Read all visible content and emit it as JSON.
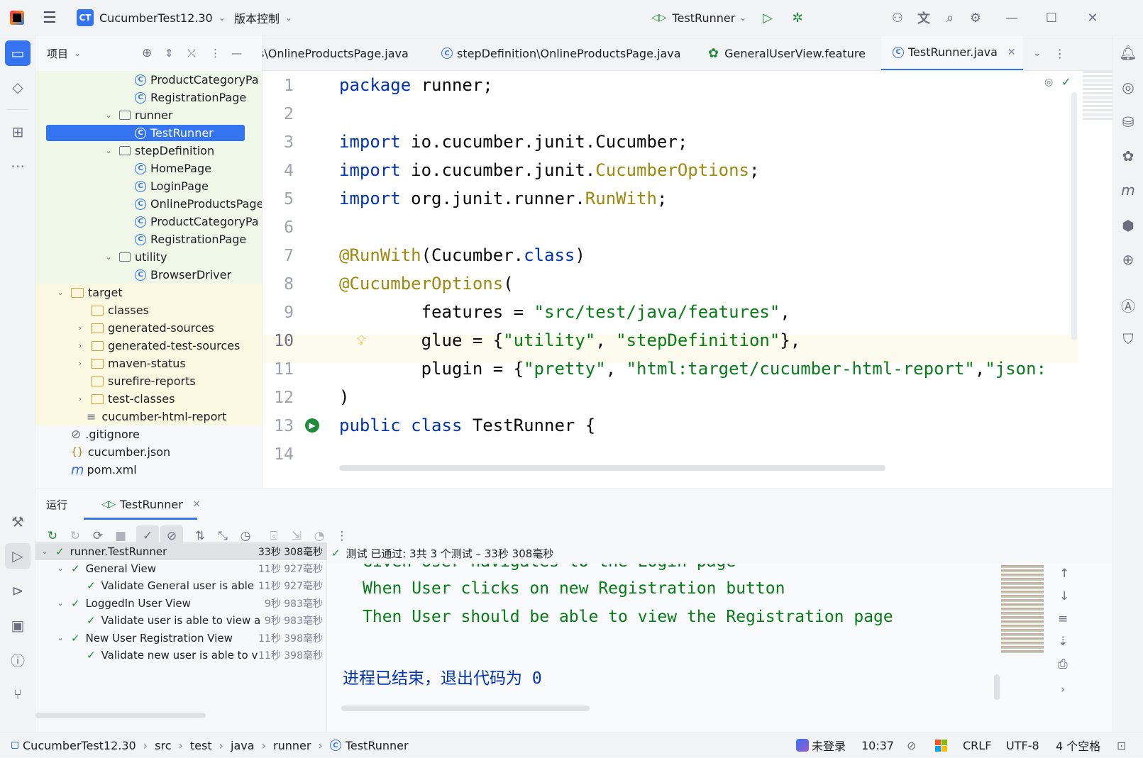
{
  "titlebar": {
    "project_name": "CucumberTest12.30",
    "project_badge": "CT",
    "vcs_label": "版本控制",
    "run_config": "TestRunner"
  },
  "project_panel": {
    "title": "项目",
    "tree": [
      {
        "label": "ProductCategoryPa",
        "type": "class",
        "indent": 3
      },
      {
        "label": "RegistrationPage",
        "type": "class",
        "indent": 3
      },
      {
        "label": "runner",
        "type": "package",
        "indent": 2,
        "expanded": true
      },
      {
        "label": "TestRunner",
        "type": "class",
        "indent": 3,
        "selected": true
      },
      {
        "label": "stepDefinition",
        "type": "package",
        "indent": 2,
        "expanded": true
      },
      {
        "label": "HomePage",
        "type": "class",
        "indent": 3
      },
      {
        "label": "LoginPage",
        "type": "class",
        "indent": 3
      },
      {
        "label": "OnlineProductsPage",
        "type": "class",
        "indent": 3
      },
      {
        "label": "ProductCategoryPa",
        "type": "class",
        "indent": 3
      },
      {
        "label": "RegistrationPage",
        "type": "class",
        "indent": 3
      },
      {
        "label": "utility",
        "type": "package",
        "indent": 2,
        "expanded": true
      },
      {
        "label": "BrowserDriver",
        "type": "class",
        "indent": 3
      },
      {
        "label": "target",
        "type": "folder",
        "indent": 0,
        "expanded": true
      },
      {
        "label": "classes",
        "type": "folder",
        "indent": 1
      },
      {
        "label": "generated-sources",
        "type": "folder",
        "indent": 1,
        "collapsed": true
      },
      {
        "label": "generated-test-sources",
        "type": "folder",
        "indent": 1,
        "collapsed": true
      },
      {
        "label": "maven-status",
        "type": "folder",
        "indent": 1,
        "collapsed": true
      },
      {
        "label": "surefire-reports",
        "type": "folder",
        "indent": 1
      },
      {
        "label": "test-classes",
        "type": "folder",
        "indent": 1,
        "collapsed": true
      },
      {
        "label": "cucumber-html-report",
        "type": "file",
        "indent": 1
      },
      {
        "label": ".gitignore",
        "type": "ignore",
        "indent": 0
      },
      {
        "label": "cucumber.json",
        "type": "json",
        "indent": 0
      },
      {
        "label": "pom.xml",
        "type": "maven",
        "indent": 0
      }
    ]
  },
  "tabs": [
    {
      "label": "s\\OnlineProductsPage.java",
      "icon": "class-icon"
    },
    {
      "label": "stepDefinition\\OnlineProductsPage.java",
      "icon": "class-icon"
    },
    {
      "label": "GeneralUserView.feature",
      "icon": "cucumber-icon"
    },
    {
      "label": "TestRunner.java",
      "icon": "class-icon",
      "active": true
    }
  ],
  "editor": {
    "line_numbers": [
      "1",
      "2",
      "3",
      "4",
      "5",
      "6",
      "7",
      "8",
      "9",
      "10",
      "11",
      "12",
      "13",
      "14"
    ],
    "lines": [
      [
        {
          "t": "package",
          "c": "kw"
        },
        {
          "t": " runner;",
          "c": ""
        }
      ],
      [],
      [
        {
          "t": "import",
          "c": "kw"
        },
        {
          "t": " io.cucumber.junit.Cucumber;",
          "c": ""
        }
      ],
      [
        {
          "t": "import",
          "c": "kw"
        },
        {
          "t": " io.cucumber.junit.",
          "c": ""
        },
        {
          "t": "CucumberOptions",
          "c": "ann"
        },
        {
          "t": ";",
          "c": ""
        }
      ],
      [
        {
          "t": "import",
          "c": "kw"
        },
        {
          "t": " org.junit.runner.",
          "c": ""
        },
        {
          "t": "RunWith",
          "c": "ann"
        },
        {
          "t": ";",
          "c": ""
        }
      ],
      [],
      [
        {
          "t": "@RunWith",
          "c": "ann"
        },
        {
          "t": "(Cucumber.",
          "c": ""
        },
        {
          "t": "class",
          "c": "kw"
        },
        {
          "t": ")",
          "c": ""
        }
      ],
      [
        {
          "t": "@CucumberOptions",
          "c": "ann"
        },
        {
          "t": "(",
          "c": ""
        }
      ],
      [
        {
          "t": "        features = ",
          "c": ""
        },
        {
          "t": "\"src/test/java/features\"",
          "c": "str"
        },
        {
          "t": ",",
          "c": ""
        }
      ],
      [
        {
          "t": "        glue = {",
          "c": ""
        },
        {
          "t": "\"utility\"",
          "c": "str"
        },
        {
          "t": ", ",
          "c": ""
        },
        {
          "t": "\"stepDefinition\"",
          "c": "str"
        },
        {
          "t": "},",
          "c": ""
        }
      ],
      [
        {
          "t": "        plugin = {",
          "c": ""
        },
        {
          "t": "\"pretty\"",
          "c": "str"
        },
        {
          "t": ", ",
          "c": ""
        },
        {
          "t": "\"html:target/cucumber-html-report\"",
          "c": "str"
        },
        {
          "t": ",",
          "c": ""
        },
        {
          "t": "\"json:",
          "c": "str"
        }
      ],
      [
        {
          "t": ")",
          "c": ""
        }
      ],
      [
        {
          "t": "public",
          "c": "kw"
        },
        {
          "t": " ",
          "c": ""
        },
        {
          "t": "class",
          "c": "kw"
        },
        {
          "t": " TestRunner {",
          "c": ""
        }
      ],
      []
    ]
  },
  "run_panel": {
    "title": "运行",
    "tab_label": "TestRunner",
    "status": "测试 已通过: 3共 3 个测试 – 33秒 308毫秒",
    "results": [
      {
        "label": "runner.TestRunner",
        "duration": "33秒 308毫秒",
        "indent": 0
      },
      {
        "label": "General View",
        "duration": "11秒 927毫秒",
        "indent": 1
      },
      {
        "label": "Validate General user is able",
        "duration": "11秒 927毫秒",
        "indent": 2
      },
      {
        "label": "LoggedIn User View",
        "duration": "9秒 983毫秒",
        "indent": 1
      },
      {
        "label": "Validate user is able to view a",
        "duration": "9秒 983毫秒",
        "indent": 2
      },
      {
        "label": "New User Registration View",
        "duration": "11秒 398毫秒",
        "indent": 1
      },
      {
        "label": "Validate new user is able to v",
        "duration": "11秒 398毫秒",
        "indent": 2
      }
    ],
    "console": [
      "Given User navigates to the Login page",
      "When User clicks on new Registration button",
      "Then User should be able to view the Registration page"
    ],
    "exit_message": "进程已结束，退出代码为 0"
  },
  "statusbar": {
    "breadcrumbs": [
      "CucumberTest12.30",
      "src",
      "test",
      "java",
      "runner",
      "TestRunner"
    ],
    "login": "未登录",
    "position": "10:37",
    "line_ending": "CRLF",
    "encoding": "UTF-8",
    "indent": "4 个空格"
  },
  "colors": {
    "accent": "#3574f0",
    "pass": "#208a3c",
    "keyword": "#0033b3",
    "string": "#067d17",
    "annotation": "#9e880d"
  }
}
